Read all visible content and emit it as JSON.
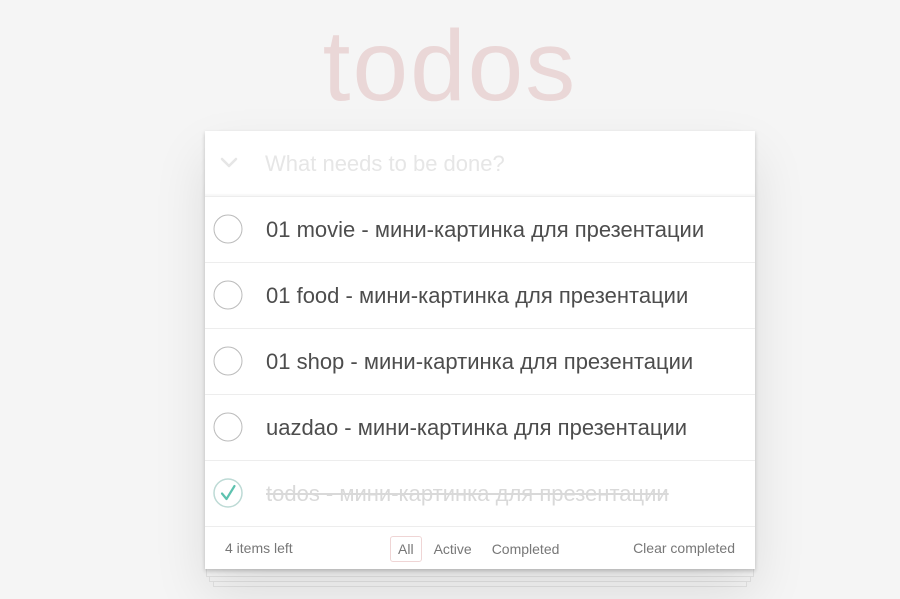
{
  "app": {
    "title": "todos"
  },
  "new_todo": {
    "placeholder": "What needs to be done?",
    "toggle_all_icon": "chevron-down-icon"
  },
  "todos": [
    {
      "title": "01 movie - мини-картинка для презентации",
      "completed": false
    },
    {
      "title": "01 food - мини-картинка для презентации",
      "completed": false
    },
    {
      "title": "01 shop - мини-картинка для презентации",
      "completed": false
    },
    {
      "title": "uazdao - мини-картинка для презентации",
      "completed": false
    },
    {
      "title": "todos - мини-картинка для презентации",
      "completed": true
    }
  ],
  "footer": {
    "items_left": "4 items left",
    "filters": [
      {
        "label": "All",
        "selected": true
      },
      {
        "label": "Active",
        "selected": false
      },
      {
        "label": "Completed",
        "selected": false
      }
    ],
    "clear_completed": "Clear completed"
  },
  "colors": {
    "title": "#af2f2f",
    "check_done": "#5dc2af",
    "check_border": "#bbbbbb",
    "text": "#4d4d4d",
    "completed_text": "#d9d9d9"
  }
}
